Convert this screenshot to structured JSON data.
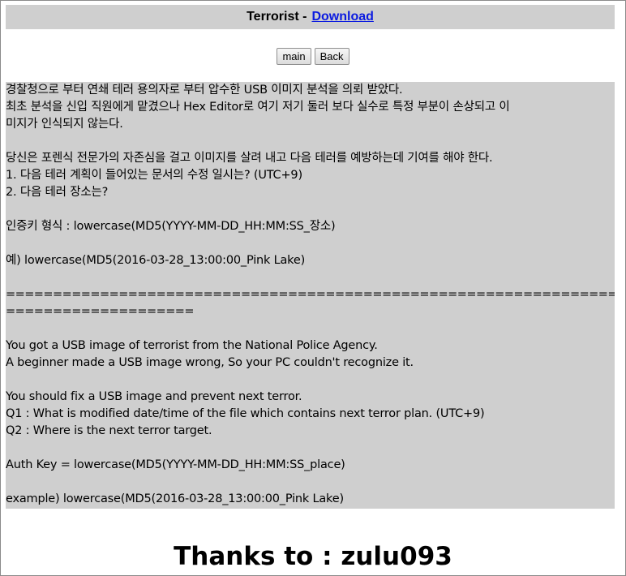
{
  "header": {
    "title": "Terrorist -",
    "download_link": "Download"
  },
  "buttons": {
    "main": "main",
    "back": "Back"
  },
  "description_lines": [
    "경찰청으로 부터 연쇄 테러 용의자로 부터 압수한 USB 이미지 분석을 의뢰 받았다.",
    "최초 분석을 신입 직원에게 맡겼으나 Hex Editor로 여기 저기 둘러 보다 실수로 특정 부분이 손상되고 이",
    "미지가 인식되지 않는다.",
    "",
    "당신은 포렌식 전문가의 자존심을 걸고 이미지를 살려 내고 다음 테러를 예방하는데 기여를 해야 한다.",
    "1. 다음 테러 계획이 들어있는 문서의 수정 일시는? (UTC+9)",
    "2. 다음 테러 장소는?",
    "",
    "인증키 형식 : lowercase(MD5(YYYY-MM-DD_HH:MM:SS_장소)",
    "",
    "예) lowercase(MD5(2016-03-28_13:00:00_Pink Lake)",
    "",
    "==================================================================",
    "====================",
    "",
    "You got a USB image of terrorist from the National Police Agency.",
    "A beginner made a USB image wrong, So your PC couldn't recognize it.",
    "",
    "You should fix a USB image and prevent next terror.",
    "Q1 : What is modified date/time of the file which contains next terror plan. (UTC+9)",
    "Q2 : Where is the next terror target.",
    "",
    "Auth Key = lowercase(MD5(YYYY-MM-DD_HH:MM:SS_place)",
    "",
    "example) lowercase(MD5(2016-03-28_13:00:00_Pink Lake)"
  ],
  "footer": {
    "thanks": "Thanks to : zulu093"
  }
}
